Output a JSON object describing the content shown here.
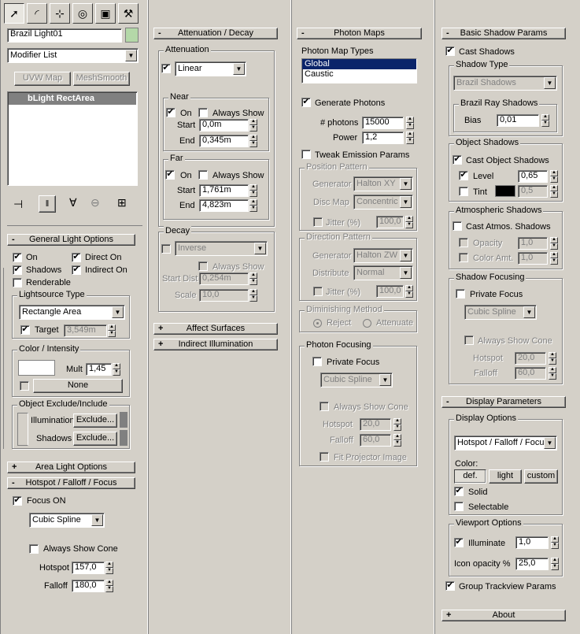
{
  "top_tabs": [
    {
      "icon": "create-arrow-icon",
      "glyph": "➚"
    },
    {
      "icon": "modify-icon",
      "glyph": "◜"
    },
    {
      "icon": "hierarchy-icon",
      "glyph": "⊹"
    },
    {
      "icon": "motion-icon",
      "glyph": "◎"
    },
    {
      "icon": "display-icon",
      "glyph": "▣"
    },
    {
      "icon": "utilities-hammer-icon",
      "glyph": "⚒"
    }
  ],
  "object_name": "Brazil Light01",
  "modifier_list": "Modifier List",
  "uvw_map": "UVW Map",
  "mesh_smooth": "MeshSmooth",
  "stack_item": "bLight RectArea",
  "general": {
    "title": "General Light Options",
    "on": "On",
    "direct_on": "Direct On",
    "shadows": "Shadows",
    "indirect_on": "Indirect On",
    "renderable": "Renderable",
    "lightsource_type": "Lightsource Type",
    "type_value": "Rectangle Area",
    "target": "Target",
    "target_value": "3,549m",
    "color_intensity": "Color / Intensity",
    "mult": "Mult",
    "mult_value": "1,45",
    "none": "None",
    "exclude_group": "Object Exclude/Include",
    "illumination": "Illumination",
    "shadows_lbl": "Shadows",
    "exclude": "Exclude..."
  },
  "area_light_options": "Area Light Options",
  "hotspot_rollout": {
    "title": "Hotspot / Falloff / Focus",
    "focus_on": "Focus ON",
    "mode": "Cubic Spline",
    "always_show_cone": "Always Show Cone",
    "hotspot": "Hotspot",
    "hotspot_value": "157,0",
    "falloff": "Falloff",
    "falloff_value": "180,0"
  },
  "attenuation": {
    "title": "Attenuation / Decay",
    "group": "Attenuation",
    "mode": "Linear",
    "near": "Near",
    "near_on": "On",
    "always_show": "Always Show",
    "start": "Start",
    "near_start": "0,0m",
    "end": "End",
    "near_end": "0,345m",
    "far": "Far",
    "far_on": "On",
    "far_start": "1,761m",
    "far_end": "4,823m",
    "decay": "Decay",
    "decay_mode": "Inverse",
    "decay_always_show": "Always Show",
    "start_dist": "Start Dist",
    "start_dist_value": "0,254m",
    "scale": "Scale",
    "scale_value": "10,0"
  },
  "affect_surfaces": "Affect Surfaces",
  "indirect_illumination": "Indirect Illumination",
  "photon_maps": {
    "title": "Photon Maps",
    "types_label": "Photon Map Types",
    "types": [
      "Global",
      "Caustic"
    ],
    "generate_photons": "Generate Photons",
    "num_photons": "# photons",
    "num_photons_value": "15000",
    "power": "Power",
    "power_value": "1,2",
    "tweak": "Tweak Emission Params",
    "position_pattern": "Position Pattern",
    "generator": "Generator",
    "pos_generator": "Halton XY",
    "disc_map": "Disc Map",
    "disc_map_value": "Concentric M",
    "jitter": "Jitter (%)",
    "pos_jitter": "100,0",
    "direction_pattern": "Direction Pattern",
    "dir_generator": "Halton ZW",
    "distribute": "Distribute",
    "distribute_value": "Normal",
    "dir_jitter": "100,0",
    "diminishing": "Diminishing Method",
    "reject": "Reject",
    "attenuate": "Attenuate",
    "photon_focusing": "Photon Focusing",
    "private_focus": "Private Focus",
    "focus_mode": "Cubic Spline",
    "always_show_cone": "Always Show Cone",
    "hotspot": "Hotspot",
    "hotspot_value": "20,0",
    "falloff": "Falloff",
    "falloff_value": "60,0",
    "fit_projector": "Fit Projector Image"
  },
  "shadow": {
    "title": "Basic Shadow Params",
    "cast_shadows": "Cast Shadows",
    "shadow_type": "Shadow Type",
    "shadow_type_value": "Brazil Shadows",
    "ray_shadows": "Brazil Ray Shadows",
    "bias": "Bias",
    "bias_value": "0,01",
    "object_shadows": "Object Shadows",
    "cast_object_shadows": "Cast Object Shadows",
    "level": "Level",
    "level_value": "0,65",
    "tint": "Tint",
    "tint_value": "0,5",
    "atmospheric": "Atmospheric Shadows",
    "cast_atmos": "Cast Atmos. Shadows",
    "opacity": "Opacity",
    "opacity_value": "1,0",
    "color_amt": "Color Amt.",
    "color_amt_value": "1,0",
    "shadow_focusing": "Shadow Focusing",
    "private_focus": "Private Focus",
    "focus_mode": "Cubic Spline",
    "always_show_cone": "Always Show Cone",
    "hotspot": "Hotspot",
    "hotspot_value": "20,0",
    "falloff": "Falloff",
    "falloff_value": "60,0"
  },
  "display": {
    "title": "Display Parameters",
    "options": "Display Options",
    "mode": "Hotspot / Falloff / Focus",
    "color": "Color:",
    "def": "def.",
    "light": "light",
    "custom": "custom",
    "solid": "Solid",
    "selectable": "Selectable",
    "viewport": "Viewport Options",
    "illuminate": "Illuminate",
    "illuminate_value": "1,0",
    "icon_opacity": "Icon opacity %",
    "icon_opacity_value": "25,0",
    "trackview": "Group Trackview Params"
  },
  "about": "About",
  "colors": {
    "swatch_green": "#b4d8a8",
    "tint_black": "#000000",
    "selection": "#0a246a"
  }
}
